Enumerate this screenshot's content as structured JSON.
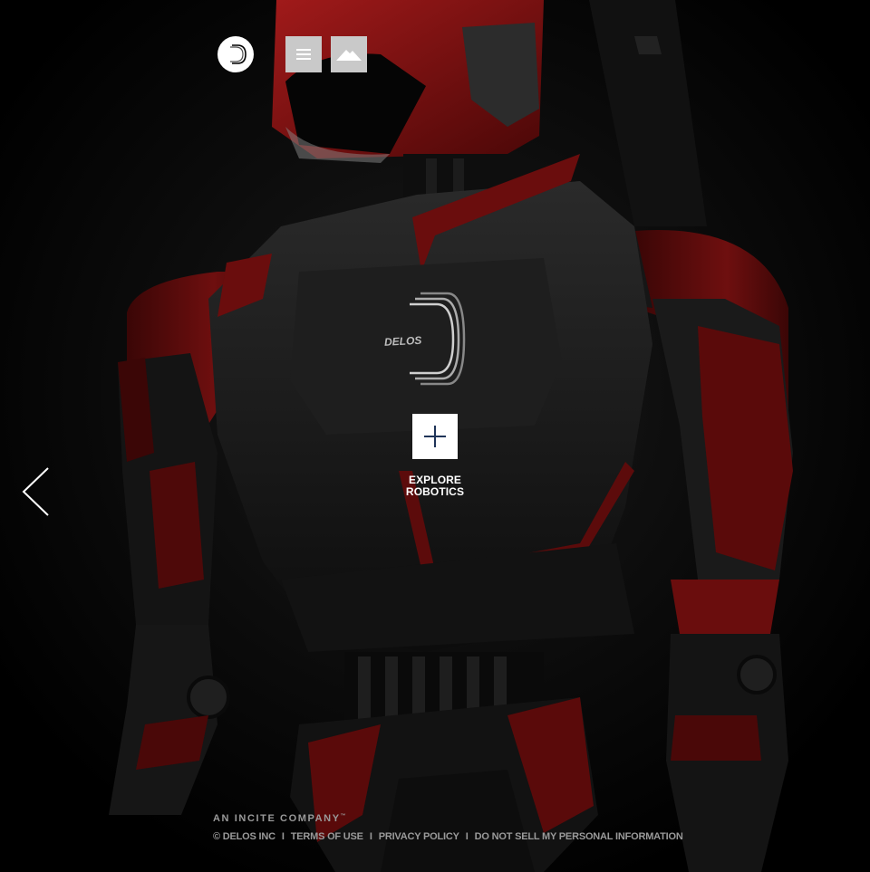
{
  "header": {
    "logo_icon": "delos-logo-icon",
    "menu_icon": "hamburger-menu-icon",
    "landscape_icon": "mountain-icon"
  },
  "hero": {
    "robot_badge": "DELOS",
    "explore": {
      "icon": "plus-icon",
      "label_line1": "EXPLORE",
      "label_line2": "ROBOTICS"
    },
    "prev_icon": "chevron-left-icon"
  },
  "footer": {
    "tagline": "AN INCITE COMPANY",
    "tagline_mark": "™",
    "copyright": "© DELOS INC",
    "separator": "I",
    "links": [
      "TERMS OF USE",
      "PRIVACY POLICY",
      "DO NOT SELL MY PERSONAL INFORMATION"
    ]
  },
  "colors": {
    "background": "#000000",
    "robot_red": "#7a1010",
    "robot_black": "#1c1c1c",
    "button_gray": "#c9c9c9",
    "footer_text": "#9a9a9a",
    "icon_navy": "#1f3458"
  }
}
